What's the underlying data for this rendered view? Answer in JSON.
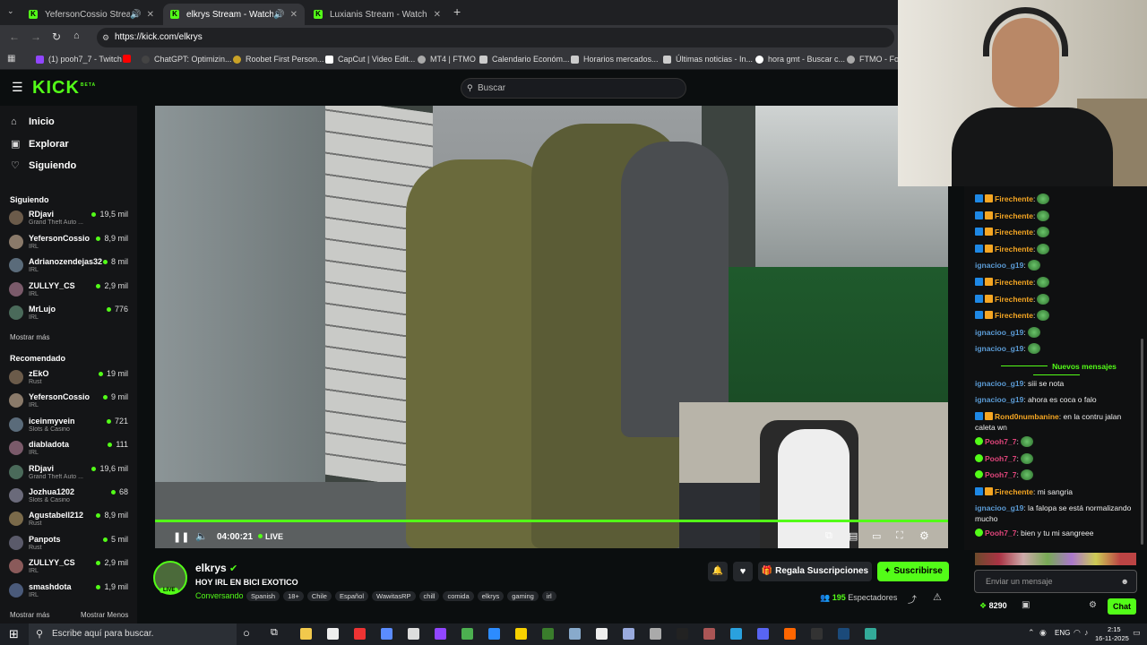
{
  "browser": {
    "tabs": [
      {
        "title": "YefersonCossio Stream - W"
      },
      {
        "title": "elkrys Stream - Watch Live"
      },
      {
        "title": "Luxianis Stream - Watch Live o"
      }
    ],
    "url": "https://kick.com/elkrys",
    "bookmarks": [
      "(1) pooh7_7 - Twitch",
      "ChatGPT: Optimizin...",
      "Roobet First Person...",
      "CapCut | Video Edit...",
      "MT4 | FTMO",
      "Calendario Económ...",
      "Horarios mercados...",
      "Últimas noticias - In...",
      "hora gmt - Buscar c...",
      "FTMO - For"
    ]
  },
  "header": {
    "logo": "KICK",
    "logo_badge": "BETA",
    "search_placeholder": "Buscar"
  },
  "nav": {
    "home": "Inicio",
    "explore": "Explorar",
    "following": "Siguiendo"
  },
  "sidebar": {
    "following_title": "Siguiendo",
    "following": [
      {
        "name": "RDjavi",
        "category": "Grand Theft Auto ...",
        "viewers": "19,5 mil"
      },
      {
        "name": "YefersonCossio",
        "category": "IRL",
        "viewers": "8,9 mil"
      },
      {
        "name": "Adrianozendejas32",
        "category": "IRL",
        "viewers": "8 mil"
      },
      {
        "name": "ZULLYY_CS",
        "category": "IRL",
        "viewers": "2,9 mil"
      },
      {
        "name": "MrLujo",
        "category": "IRL",
        "viewers": "776"
      }
    ],
    "show_more": "Mostrar más",
    "recommended_title": "Recomendado",
    "recommended": [
      {
        "name": "zEkO",
        "category": "Rust",
        "viewers": "19 mil"
      },
      {
        "name": "YefersonCossio",
        "category": "IRL",
        "viewers": "9 mil"
      },
      {
        "name": "iceinmyvein",
        "category": "Slots & Casino",
        "viewers": "721"
      },
      {
        "name": "diabladota",
        "category": "IRL",
        "viewers": "111"
      },
      {
        "name": "RDjavi",
        "category": "Grand Theft Auto ...",
        "viewers": "19,6 mil"
      },
      {
        "name": "Jozhua1202",
        "category": "Slots & Casino",
        "viewers": "68"
      },
      {
        "name": "Agustabell212",
        "category": "Rust",
        "viewers": "8,9 mil"
      },
      {
        "name": "Panpots",
        "category": "Rust",
        "viewers": "5 mil"
      },
      {
        "name": "ZULLYY_CS",
        "category": "IRL",
        "viewers": "2,9 mil"
      },
      {
        "name": "smashdota",
        "category": "IRL",
        "viewers": "1,9 mil"
      }
    ],
    "show_more2": "Mostrar más",
    "show_less": "Mostrar Menos"
  },
  "player": {
    "time": "04:00:21",
    "live": "LIVE"
  },
  "stream": {
    "channel": "elkrys",
    "live_badge": "LIVE",
    "title": "HOY IRL EN BICI EXOTICO",
    "category": "Conversando",
    "tags": [
      "Spanish",
      "18+",
      "Chile",
      "Español",
      "WawitasRP",
      "chill",
      "comida",
      "elkrys",
      "gaming",
      "irl"
    ],
    "gift_label": "Regala Suscripciones",
    "subscribe_label": "Suscribirse",
    "viewers_count": "195",
    "viewers_label": "Espectadores"
  },
  "chat": {
    "messages": [
      {
        "user": "Firechente",
        "text": ":",
        "emote": true,
        "color": "#f5a623"
      },
      {
        "user": "Firechente",
        "text": ":",
        "emote": true,
        "color": "#f5a623"
      },
      {
        "user": "Firechente",
        "text": ":",
        "emote": true,
        "color": "#f5a623"
      },
      {
        "user": "Firechente",
        "text": ":",
        "emote": true,
        "color": "#f5a623"
      },
      {
        "user": "ignacioo_g19",
        "text": ":",
        "emote": true,
        "color": "#5b9bd5"
      },
      {
        "user": "Firechente",
        "text": ":",
        "emote": true,
        "color": "#f5a623"
      },
      {
        "user": "Firechente",
        "text": ":",
        "emote": true,
        "color": "#f5a623"
      },
      {
        "user": "Firechente",
        "text": ":",
        "emote": true,
        "color": "#f5a623"
      },
      {
        "user": "ignacioo_g19",
        "text": ":",
        "emote": true,
        "color": "#5b9bd5"
      },
      {
        "user": "ignacioo_g19",
        "text": ":",
        "emote": true,
        "color": "#5b9bd5"
      }
    ],
    "new_messages": "Nuevos mensajes",
    "messages2": [
      {
        "user": "ignacioo_g19",
        "text": ": siii se nota",
        "color": "#5b9bd5"
      },
      {
        "user": "ignacioo_g19",
        "text": ": ahora es coca o falo",
        "color": "#5b9bd5"
      },
      {
        "user": "Rond0numbanine",
        "text": ": en la contru jalan caleta wn",
        "color": "#f5a623"
      },
      {
        "user": "Pooh7_7",
        "text": ":",
        "emote": true,
        "color": "#e0457b"
      },
      {
        "user": "Pooh7_7",
        "text": ":",
        "emote": true,
        "color": "#e0457b"
      },
      {
        "user": "Pooh7_7",
        "text": ":",
        "emote": true,
        "color": "#e0457b"
      },
      {
        "user": "Firechente",
        "text": ": mi sangria",
        "color": "#f5a623"
      },
      {
        "user": "ignacioo_g19",
        "text": ": la falopa se está normalizando mucho",
        "color": "#5b9bd5"
      },
      {
        "user": "Pooh7_7",
        "text": ": bien y tu mi sangreee",
        "color": "#e0457b"
      }
    ],
    "input_placeholder": "Enviar un mensaje",
    "points": "8290",
    "send_label": "Chat"
  },
  "taskbar": {
    "search_placeholder": "Escribe aquí para buscar.",
    "lang": "ENG",
    "time": "2:15",
    "date": "16-11-2025"
  },
  "colors": {
    "accent": "#53fc18",
    "bg": "#0b0e0f"
  }
}
